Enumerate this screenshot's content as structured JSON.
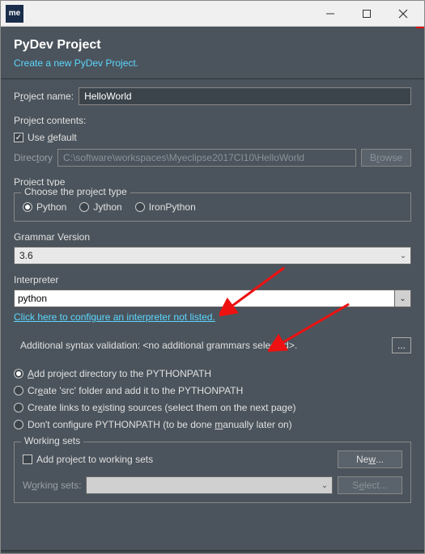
{
  "titlebar": {
    "icon_text": "me"
  },
  "header": {
    "title": "PyDev Project",
    "subtitle": "Create a new PyDev Project."
  },
  "project_name": {
    "label_pre": "P",
    "label_mid": "r",
    "label_post": "oject name:",
    "value": "HelloWorld"
  },
  "contents": {
    "heading": "Project contents:",
    "use_default_pre": "Use ",
    "use_default_u": "d",
    "use_default_post": "efault",
    "use_default_checked": true,
    "dir_label_pre": "Direc",
    "dir_label_u": "t",
    "dir_label_post": "ory",
    "dir_value": "C:\\software\\workspaces\\Myeclipse2017CI10\\HelloWorld",
    "browse_pre": "B",
    "browse_u": "r",
    "browse_post": "owse"
  },
  "project_type": {
    "heading": "Project type",
    "legend": "Choose the project type",
    "opts": [
      "Python",
      "Jython",
      "IronPython"
    ],
    "selected": 0
  },
  "grammar": {
    "label": "Grammar Version",
    "value": "3.6"
  },
  "interpreter": {
    "label": "Interpreter",
    "value": "python",
    "link": "Click here to configure an interpreter not listed."
  },
  "additional": {
    "label": "Additional syntax validation: <no additional grammars selected>."
  },
  "pythonpath": {
    "opts": [
      {
        "pre": "",
        "u": "A",
        "post": "dd project directory to the PYTHONPATH",
        "sel": true
      },
      {
        "pre": "Cr",
        "u": "e",
        "post": "ate 'src' folder and add it to the PYTHONPATH",
        "sel": false
      },
      {
        "pre": "Create links to e",
        "u": "x",
        "post": "isting sources (select them on the next page)",
        "sel": false
      },
      {
        "pre": "Don't configure PYTHONPATH (to be done ",
        "u": "m",
        "post": "anually later on)",
        "sel": false
      }
    ]
  },
  "working_sets": {
    "legend": "Working sets",
    "add_label": "Add project to working sets",
    "add_checked": false,
    "new_pre": "Ne",
    "new_u": "w",
    "new_post": "...",
    "ws_label_pre": "W",
    "ws_label_u": "o",
    "ws_label_post": "rking sets:",
    "select_pre": "S",
    "select_u": "e",
    "select_post": "lect..."
  }
}
